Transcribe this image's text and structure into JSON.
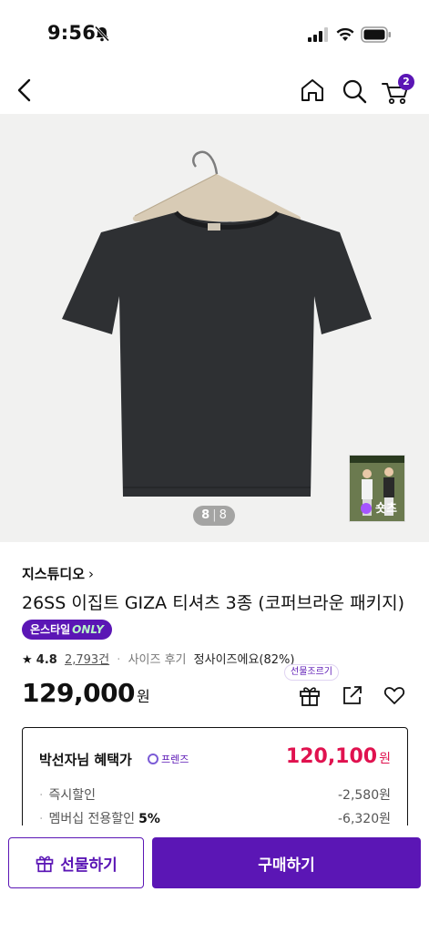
{
  "status_bar": {
    "time": "9:56"
  },
  "header": {
    "cart_count": "2"
  },
  "gallery": {
    "current": "8",
    "total": "8",
    "shorts_label": "숏츠"
  },
  "product": {
    "brand": "지스튜디오",
    "title": "26SS 이집트 GIZA 티셔츠 3종 (코퍼브라운 패키지)",
    "badge_prefix": "온스타일",
    "badge_suffix": "ONLY",
    "rating": "4.8",
    "review_count": "2,793건",
    "size_review_label": "사이즈 후기",
    "size_review_value": "정사이즈에요(82%)",
    "price": "129,000",
    "price_unit": "원",
    "gift_hint": "선물조르기"
  },
  "benefit": {
    "title": "박선자님 혜택가",
    "tier": "프렌즈",
    "price": "120,100",
    "price_unit": "원",
    "rows": [
      {
        "label": "즉시할인",
        "percent": "",
        "amount": "-2,580원"
      },
      {
        "label": "멤버십 전용할인",
        "percent": "5%",
        "amount": "-6,320원"
      }
    ]
  },
  "bottom_bar": {
    "gift_label": "선물하기",
    "buy_label": "구매하기"
  },
  "colors": {
    "brand": "#5b16b5",
    "sale": "#e0124f",
    "image_bg": "#f1f1f0"
  }
}
